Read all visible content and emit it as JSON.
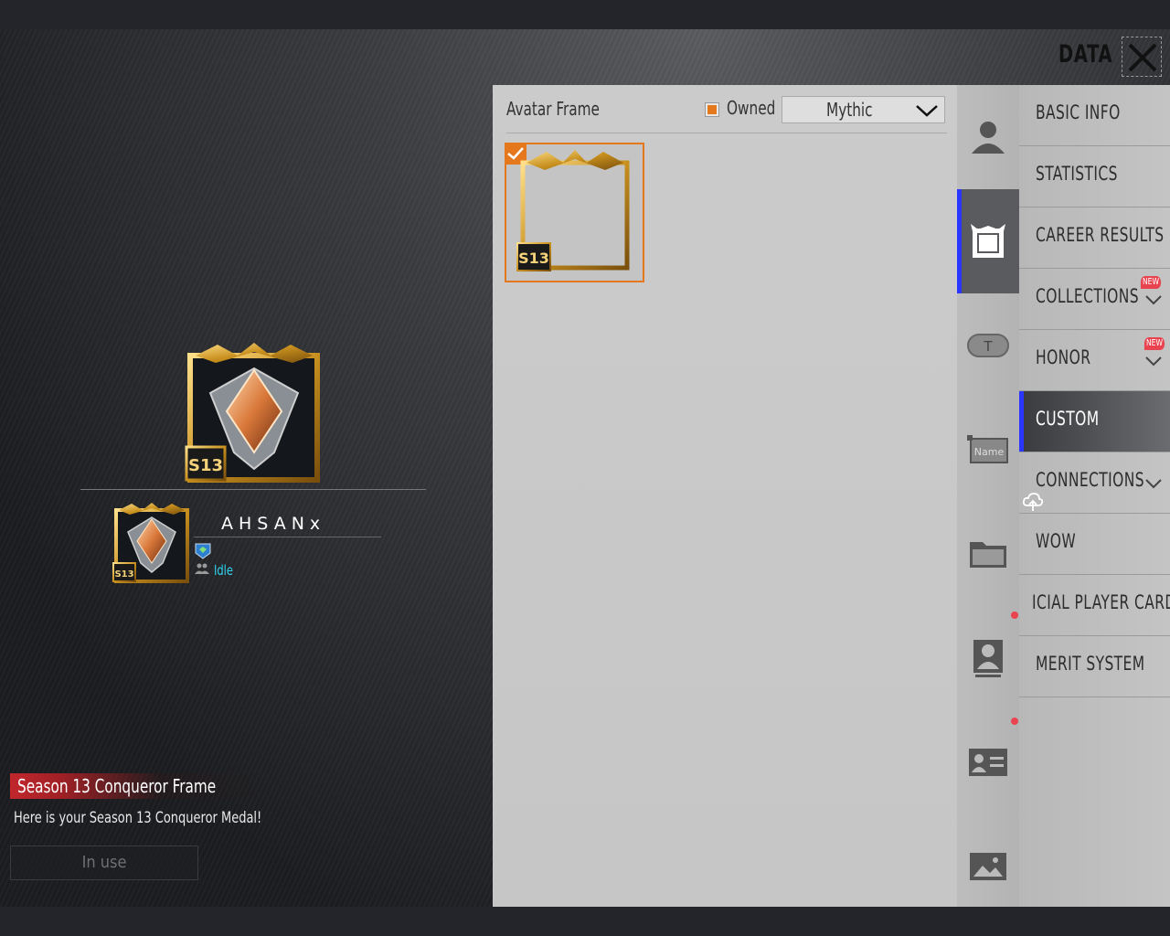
{
  "header": {
    "title": "DATA"
  },
  "player": {
    "name": "AHSANx",
    "status": "Idle"
  },
  "selected_item": {
    "title": "Season 13 Conqueror Frame",
    "description": "Here is your Season 13 Conqueror Medal!",
    "action_label": "In use",
    "badge_text": "S13"
  },
  "frames_panel": {
    "title": "Avatar Frame",
    "owned_label": "Owned",
    "owned_checked": true,
    "filter_value": "Mythic",
    "frames": [
      {
        "badge_text": "S13",
        "selected": true
      }
    ]
  },
  "icon_tabs": [
    {
      "icon": "person-icon"
    },
    {
      "icon": "avatar-frame-icon",
      "active": true
    },
    {
      "icon": "title-tag-icon"
    },
    {
      "icon": "name-card-icon",
      "text": "Name"
    },
    {
      "icon": "folder-icon"
    },
    {
      "icon": "portrait-icon"
    },
    {
      "icon": "id-card-icon"
    },
    {
      "icon": "picture-icon"
    }
  ],
  "menu": {
    "items": [
      {
        "label": "BASIC INFO"
      },
      {
        "label": "STATISTICS"
      },
      {
        "label": "CAREER RESULTS"
      },
      {
        "label": "COLLECTIONS",
        "badge": "NEW",
        "expandable": true
      },
      {
        "label": "HONOR",
        "badge": "NEW",
        "expandable": true
      },
      {
        "label": "CUSTOM",
        "active": true
      },
      {
        "label": "CONNECTIONS",
        "expandable": true
      },
      {
        "label": "WOW"
      },
      {
        "label": "ICIAL PLAYER CARD"
      },
      {
        "label": "MERIT SYSTEM"
      }
    ]
  },
  "colors": {
    "accent_orange": "#e5781c",
    "active_blue": "#2a35ff",
    "title_red": "#c1272d",
    "status_cyan": "#2fd4f2",
    "badge_red": "#e8434f"
  }
}
